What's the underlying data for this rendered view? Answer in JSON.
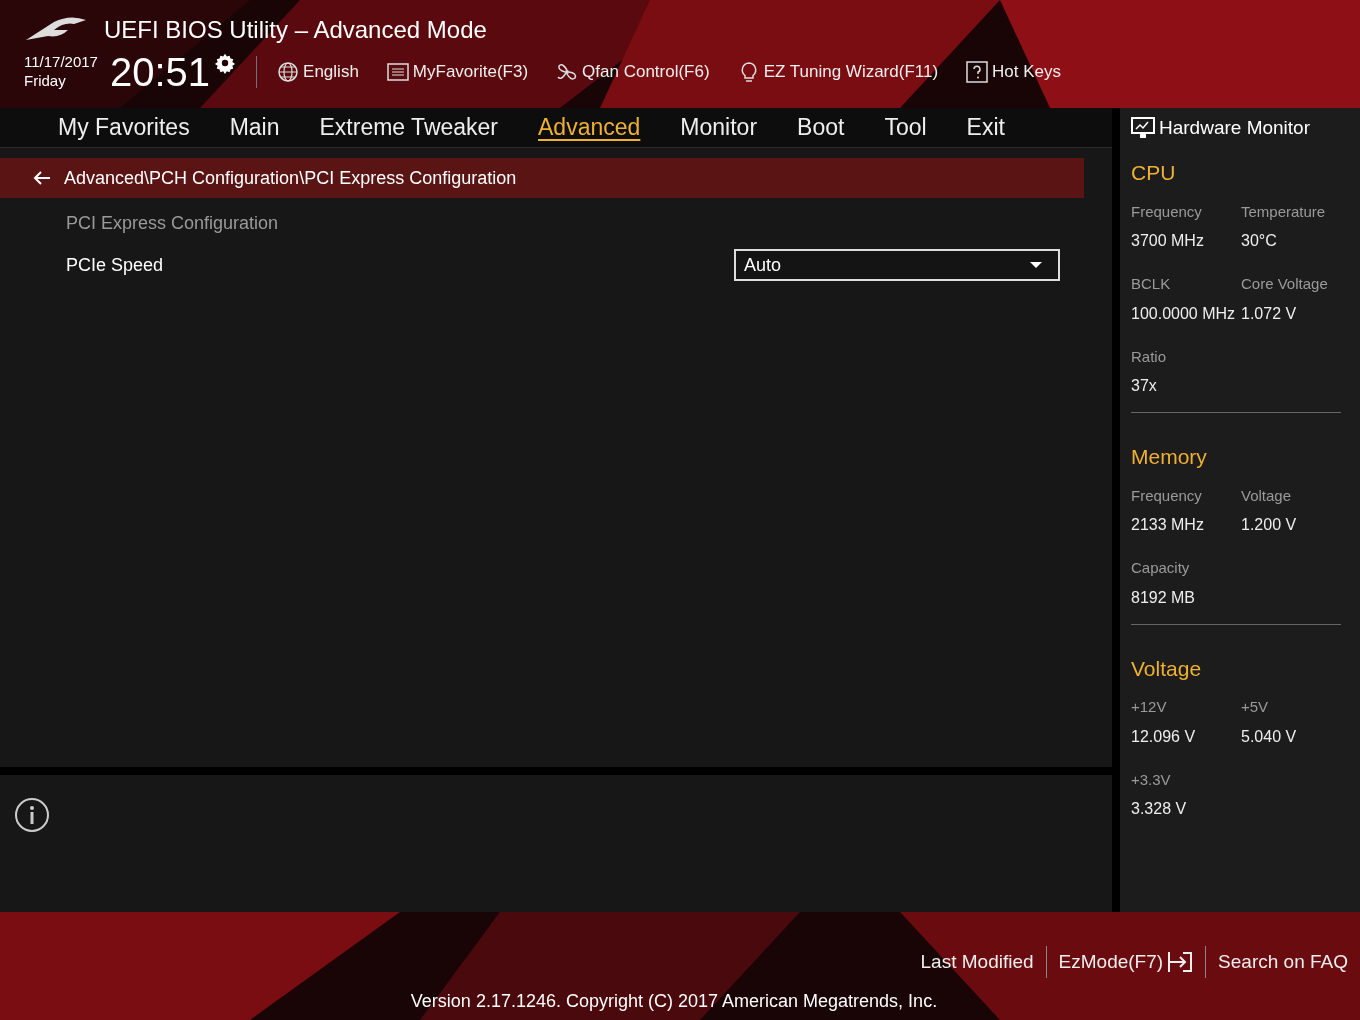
{
  "header": {
    "title": "UEFI BIOS Utility – Advanced Mode",
    "date": "11/17/2017",
    "day": "Friday",
    "time": "20:51",
    "tools": [
      {
        "label": "English"
      },
      {
        "label": "MyFavorite(F3)"
      },
      {
        "label": "Qfan Control(F6)"
      },
      {
        "label": "EZ Tuning Wizard(F11)"
      },
      {
        "label": "Hot Keys"
      }
    ]
  },
  "tabs": [
    {
      "label": "My Favorites",
      "selected": false
    },
    {
      "label": "Main",
      "selected": false
    },
    {
      "label": "Extreme Tweaker",
      "selected": false
    },
    {
      "label": "Advanced",
      "selected": true
    },
    {
      "label": "Monitor",
      "selected": false
    },
    {
      "label": "Boot",
      "selected": false
    },
    {
      "label": "Tool",
      "selected": false
    },
    {
      "label": "Exit",
      "selected": false
    }
  ],
  "breadcrumb": "Advanced\\PCH Configuration\\PCI Express Configuration",
  "section_title": "PCI Express Configuration",
  "settings": [
    {
      "label": "PCIe Speed",
      "value": "Auto"
    }
  ],
  "hardware_monitor": {
    "title": "Hardware Monitor",
    "groups": [
      {
        "title": "CPU",
        "items": [
          {
            "label": "Frequency",
            "value": "3700 MHz"
          },
          {
            "label": "Temperature",
            "value": "30°C"
          },
          {
            "label": "BCLK",
            "value": "100.0000 MHz"
          },
          {
            "label": "Core Voltage",
            "value": "1.072 V"
          },
          {
            "label": "Ratio",
            "value": "37x"
          }
        ]
      },
      {
        "title": "Memory",
        "items": [
          {
            "label": "Frequency",
            "value": "2133 MHz"
          },
          {
            "label": "Voltage",
            "value": "1.200 V"
          },
          {
            "label": "Capacity",
            "value": "8192 MB"
          }
        ]
      },
      {
        "title": "Voltage",
        "items": [
          {
            "label": "+12V",
            "value": "12.096 V"
          },
          {
            "label": "+5V",
            "value": "5.040 V"
          },
          {
            "label": "+3.3V",
            "value": "3.328 V"
          }
        ]
      }
    ]
  },
  "footer": {
    "links": [
      "Last Modified",
      "EzMode(F7)",
      "Search on FAQ"
    ],
    "version": "Version 2.17.1246. Copyright (C) 2017 American Megatrends, Inc."
  }
}
